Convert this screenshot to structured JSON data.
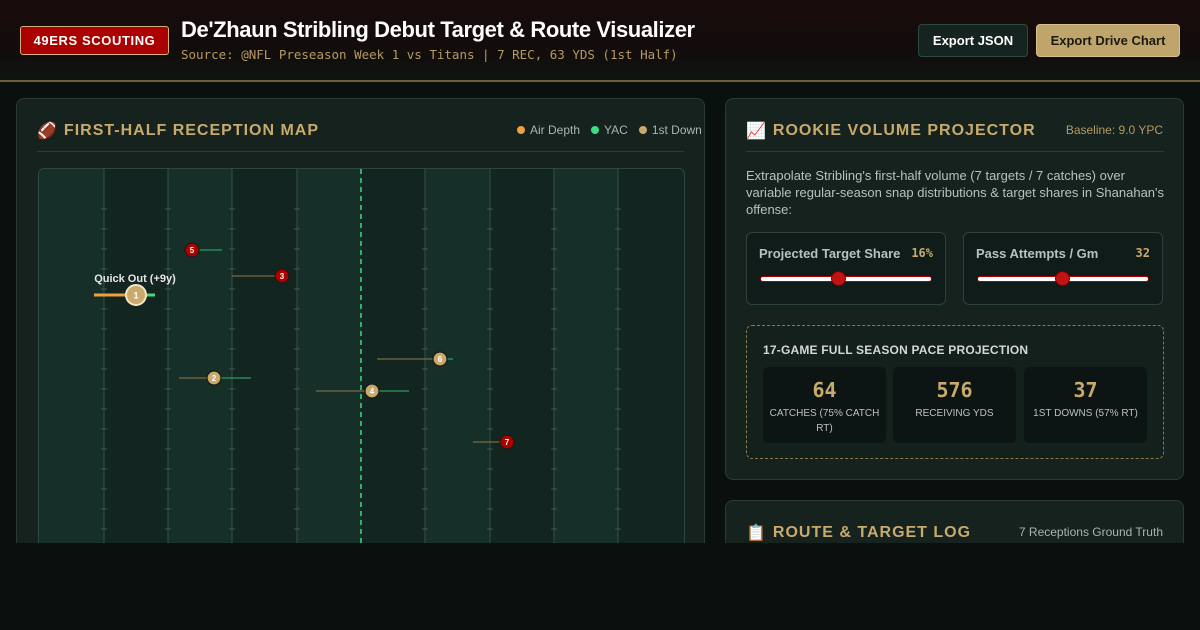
{
  "header": {
    "badge": "49ERS SCOUTING",
    "title": "De'Zhaun Stribling Debut Target & Route Visualizer",
    "subtitle": "Source: @NFL Preseason Week 1 vs Titans | 7 REC, 63 YDS (1st Half)",
    "export_json": "Export JSON",
    "export_drive": "Export Drive Chart"
  },
  "map_panel": {
    "icon": "football-icon",
    "title": "FIRST-HALF RECEPTION MAP",
    "legend": [
      {
        "label": "Air Depth",
        "color": "#f0a040"
      },
      {
        "label": "YAC",
        "color": "#3ddc84"
      },
      {
        "label": "1st Down",
        "color": "#c9aa6c"
      }
    ],
    "tooltip": "Quick Out (+9y)",
    "receptions": [
      {
        "n": "1",
        "first_down": false
      },
      {
        "n": "2",
        "first_down": true
      },
      {
        "n": "3",
        "first_down": false
      },
      {
        "n": "4",
        "first_down": true
      },
      {
        "n": "5",
        "first_down": false
      },
      {
        "n": "6",
        "first_down": true
      },
      {
        "n": "7",
        "first_down": false
      }
    ]
  },
  "projector": {
    "icon": "chart-increasing-icon",
    "title": "ROOKIE VOLUME PROJECTOR",
    "baseline": "Baseline: 9.0 YPC",
    "description": "Extrapolate Stribling's first-half volume (7 targets / 7 catches) over variable regular-season snap distributions & target shares in Shanahan's offense:",
    "target_share": {
      "label": "Projected Target Share",
      "value": "16%",
      "fraction": 0.45
    },
    "pass_attempts": {
      "label": "Pass Attempts / Gm",
      "value": "32",
      "fraction": 0.49
    },
    "pace": {
      "title": "17-GAME FULL SEASON PACE PROJECTION",
      "stats": [
        {
          "value": "64",
          "label": "CATCHES (75% CATCH RT)"
        },
        {
          "value": "576",
          "label": "RECEIVING YDS"
        },
        {
          "value": "37",
          "label": "1ST DOWNS (57% RT)"
        }
      ]
    }
  },
  "log_panel": {
    "icon": "clipboard-icon",
    "title": "ROUTE & TARGET LOG",
    "subtitle": "7 Receptions Ground Truth"
  }
}
